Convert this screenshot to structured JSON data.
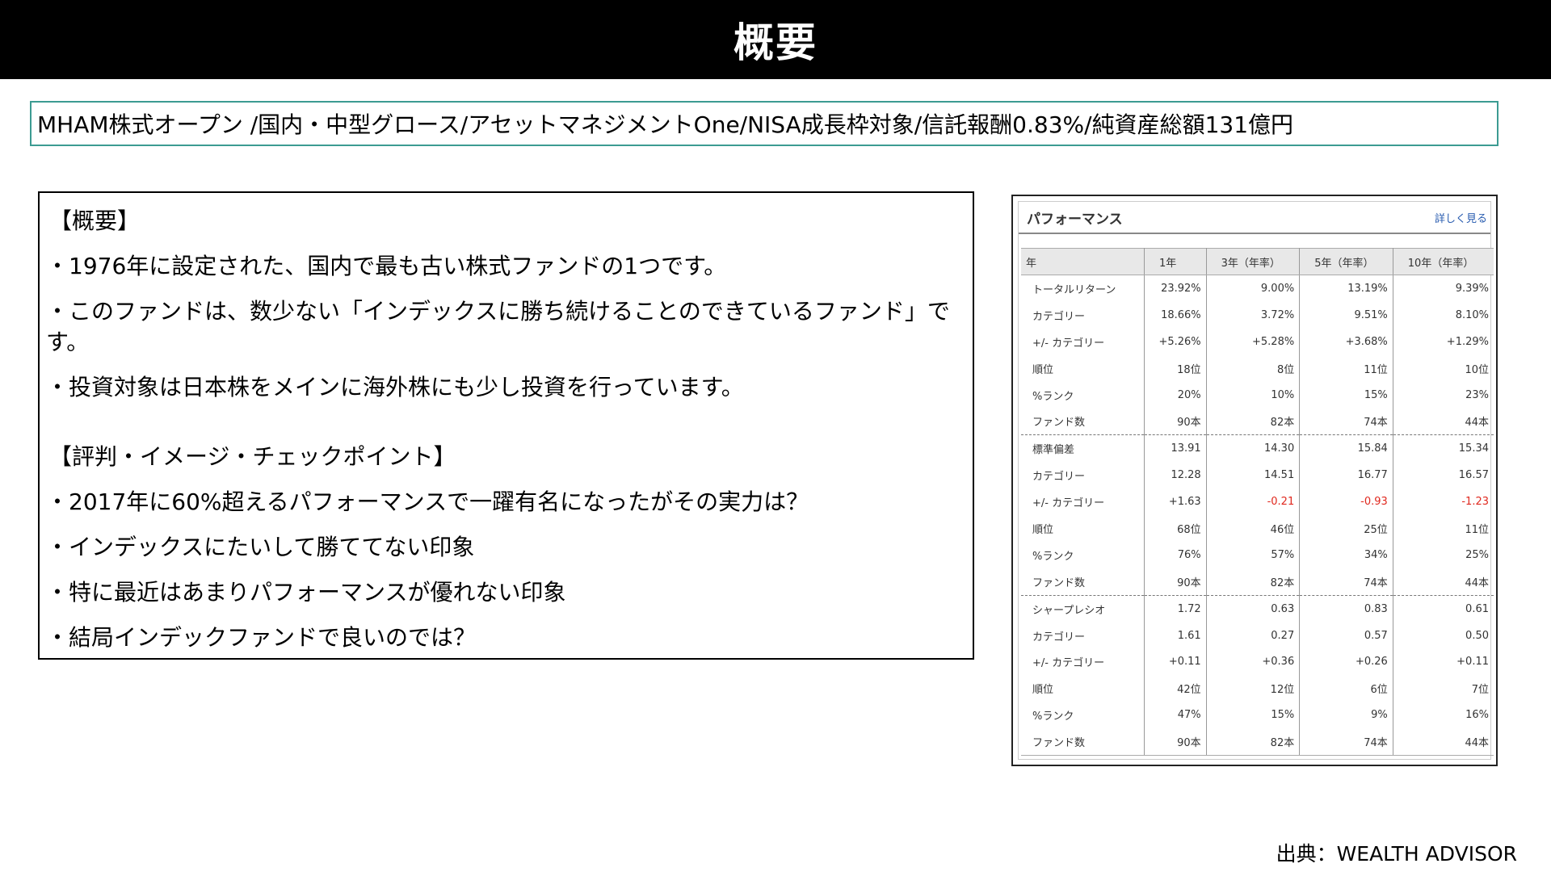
{
  "slide": {
    "title": "概要",
    "summary": "MHAM株式オープン /国内・中型グロース/アセットマネジメントOne/NISA成長枠対象/信託報酬0.83%/純資産総額131億円",
    "source": "出典：WEALTH ADVISOR"
  },
  "overview": {
    "heading1": "【概要】",
    "bullet1": "・1976年に設定された、国内で最も古い株式ファンドの1つです。",
    "bullet2": "・このファンドは、数少ない「インデックスに勝ち続けることのできているファンド」です。",
    "bullet3": "・投資対象は日本株をメインに海外株にも少し投資を行っています。",
    "heading2": "【評判・イメージ・チェックポイント】",
    "bullet4": "・2017年に60%超えるパフォーマンスで一躍有名になったがその実力は？",
    "bullet5": "・インデックスにたいして勝ててない印象",
    "bullet6": "・特に最近はあまりパフォーマンスが優れない印象",
    "bullet7": "・結局インデックファンドで良いのでは？"
  },
  "performance": {
    "title": "パフォーマンス",
    "more_link": "詳しく見る",
    "columns": [
      "年",
      "1年",
      "3年（年率）",
      "5年（年率）",
      "10年（年率）"
    ],
    "rows": [
      {
        "label": "トータルリターン",
        "v": [
          "23.92%",
          "9.00%",
          "13.19%",
          "9.39%"
        ]
      },
      {
        "label": "カテゴリー",
        "v": [
          "18.66%",
          "3.72%",
          "9.51%",
          "8.10%"
        ]
      },
      {
        "label": "+/- カテゴリー",
        "v": [
          "+5.26%",
          "+5.28%",
          "+3.68%",
          "+1.29%"
        ]
      },
      {
        "label": "順位",
        "v": [
          "18位",
          "8位",
          "11位",
          "10位"
        ]
      },
      {
        "label": "%ランク",
        "v": [
          "20%",
          "10%",
          "15%",
          "23%"
        ]
      },
      {
        "label": "ファンド数",
        "v": [
          "90本",
          "82本",
          "74本",
          "44本"
        ]
      },
      {
        "label": "標準偏差",
        "v": [
          "13.91",
          "14.30",
          "15.84",
          "15.34"
        ]
      },
      {
        "label": "カテゴリー",
        "v": [
          "12.28",
          "14.51",
          "16.77",
          "16.57"
        ]
      },
      {
        "label": "+/- カテゴリー",
        "v": [
          "+1.63",
          "-0.21",
          "-0.93",
          "-1.23"
        ]
      },
      {
        "label": "順位",
        "v": [
          "68位",
          "46位",
          "25位",
          "11位"
        ]
      },
      {
        "label": "%ランク",
        "v": [
          "76%",
          "57%",
          "34%",
          "25%"
        ]
      },
      {
        "label": "ファンド数",
        "v": [
          "90本",
          "82本",
          "74本",
          "44本"
        ]
      },
      {
        "label": "シャープレシオ",
        "v": [
          "1.72",
          "0.63",
          "0.83",
          "0.61"
        ]
      },
      {
        "label": "カテゴリー",
        "v": [
          "1.61",
          "0.27",
          "0.57",
          "0.50"
        ]
      },
      {
        "label": "+/- カテゴリー",
        "v": [
          "+0.11",
          "+0.36",
          "+0.26",
          "+0.11"
        ]
      },
      {
        "label": "順位",
        "v": [
          "42位",
          "12位",
          "6位",
          "7位"
        ]
      },
      {
        "label": "%ランク",
        "v": [
          "47%",
          "15%",
          "9%",
          "16%"
        ]
      },
      {
        "label": "ファンド数",
        "v": [
          "90本",
          "82本",
          "74本",
          "44本"
        ]
      }
    ],
    "negative_color": "#e0281e"
  }
}
